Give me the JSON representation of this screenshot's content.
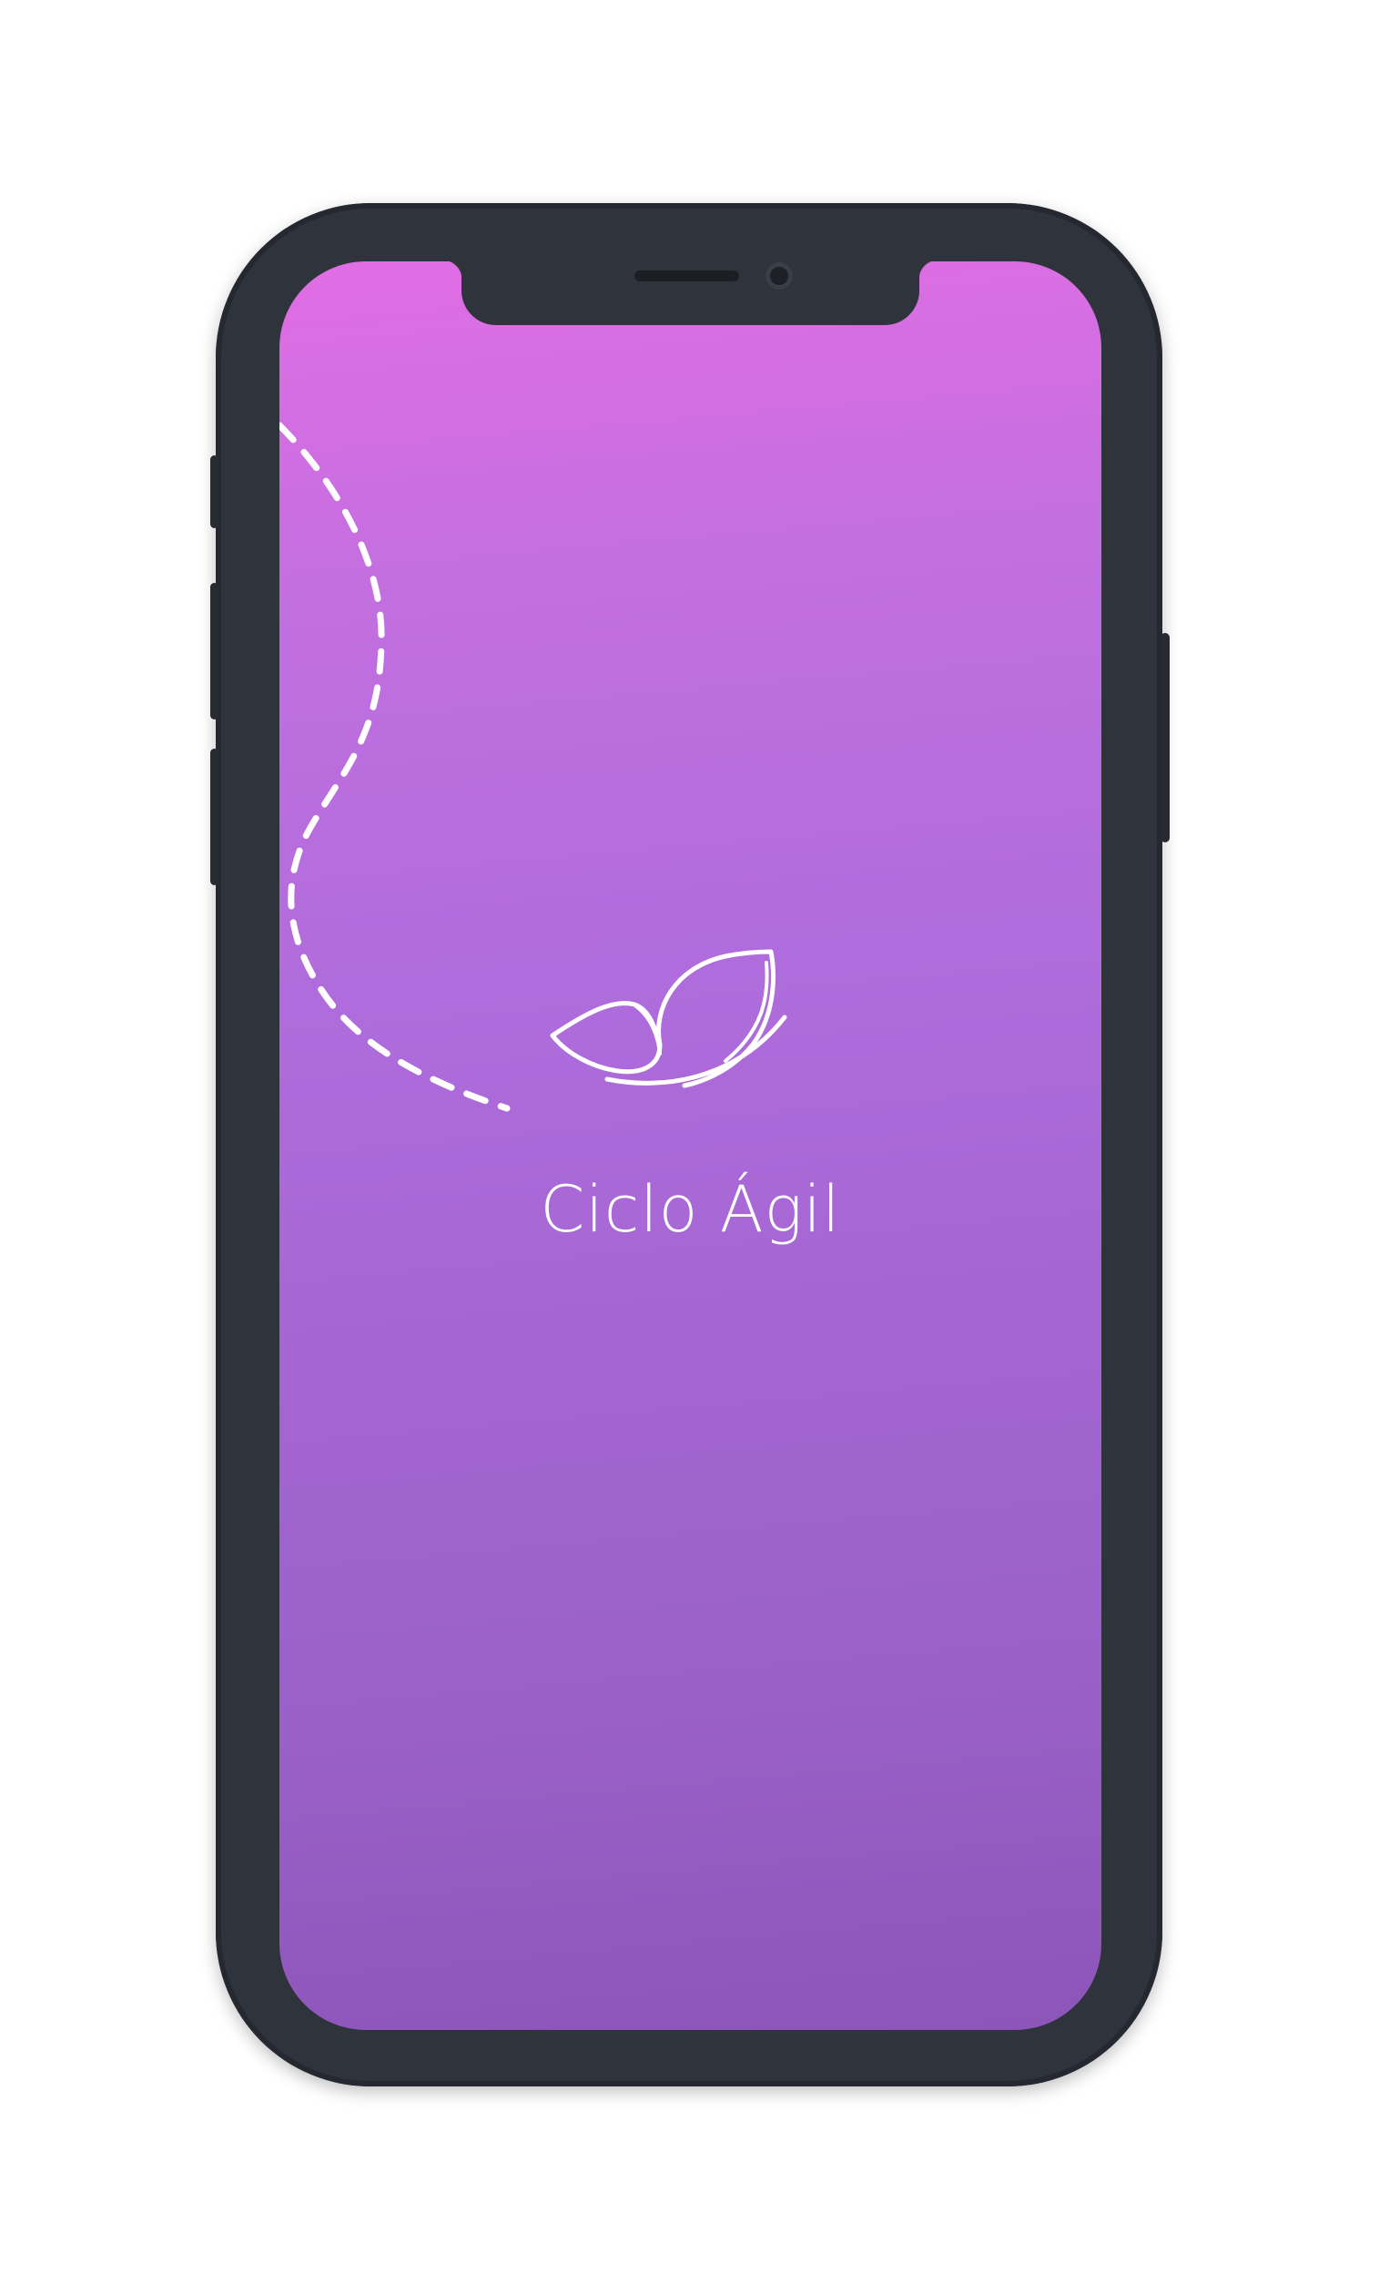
{
  "app": {
    "name": "Ciclo Ágil"
  },
  "icons": {
    "logo": "butterfly-icon",
    "flight_path": "dashed-path-icon"
  },
  "colors": {
    "gradient_top": "#e16de4",
    "gradient_bottom": "#8c55b8",
    "device_frame": "#2f333b",
    "logo_stroke": "#ffffff"
  }
}
